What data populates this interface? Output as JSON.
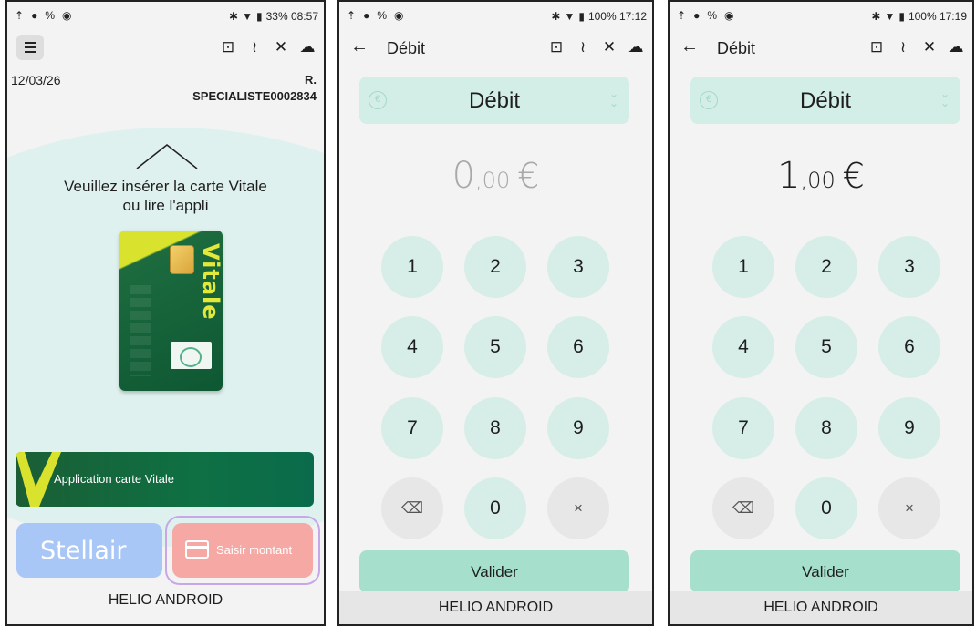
{
  "screens": [
    {
      "status": {
        "battery_time": "33% 08:57"
      },
      "date": "12/03/26",
      "user": {
        "line1": "R.",
        "line2": "SPECIALISTE0002834"
      },
      "prompt": {
        "line1": "Veuillez insérer la carte Vitale",
        "line2": "ou lire l'appli"
      },
      "card_word": "Vitale",
      "app_vitale_label": "Application carte Vitale",
      "stellair_label": "Stellair",
      "saisir_label": "Saisir montant",
      "footer": "HELIO ANDROID"
    },
    {
      "status": {
        "battery_time": "100% 17:12"
      },
      "title": "Débit",
      "dropdown_value": "Débit",
      "amount": {
        "int": "0",
        "dec": ",00",
        "currency": "€"
      },
      "keys": [
        "1",
        "2",
        "3",
        "4",
        "5",
        "6",
        "7",
        "8",
        "9",
        "⌫",
        "0",
        "×"
      ],
      "valider": "Valider",
      "footer": "HELIO ANDROID"
    },
    {
      "status": {
        "battery_time": "100% 17:19"
      },
      "title": "Débit",
      "dropdown_value": "Débit",
      "amount": {
        "int": "1",
        "dec": ",00",
        "currency": "€"
      },
      "keys": [
        "1",
        "2",
        "3",
        "4",
        "5",
        "6",
        "7",
        "8",
        "9",
        "⌫",
        "0",
        "×"
      ],
      "valider": "Valider",
      "footer": "HELIO ANDROID"
    }
  ],
  "icons": {
    "status_left": [
      "upload-icon",
      "face-icon",
      "link-icon",
      "shield-icon"
    ],
    "status_right": [
      "bluetooth-icon",
      "wifi-icon",
      "battery-icon"
    ],
    "toolbar": [
      "id-card-icon",
      "nfc-icon",
      "vitale-off-icon",
      "cloud-icon"
    ]
  },
  "colors": {
    "mint": "#d6eee7",
    "accent_green": "#a6e0cd",
    "vitale_green": "#0e5733",
    "vitale_yellow": "#d9e32e",
    "stellair_blue": "#a8c6f6",
    "saisir_red": "#f6a9a4",
    "focus_purple": "#c7a7e8"
  }
}
